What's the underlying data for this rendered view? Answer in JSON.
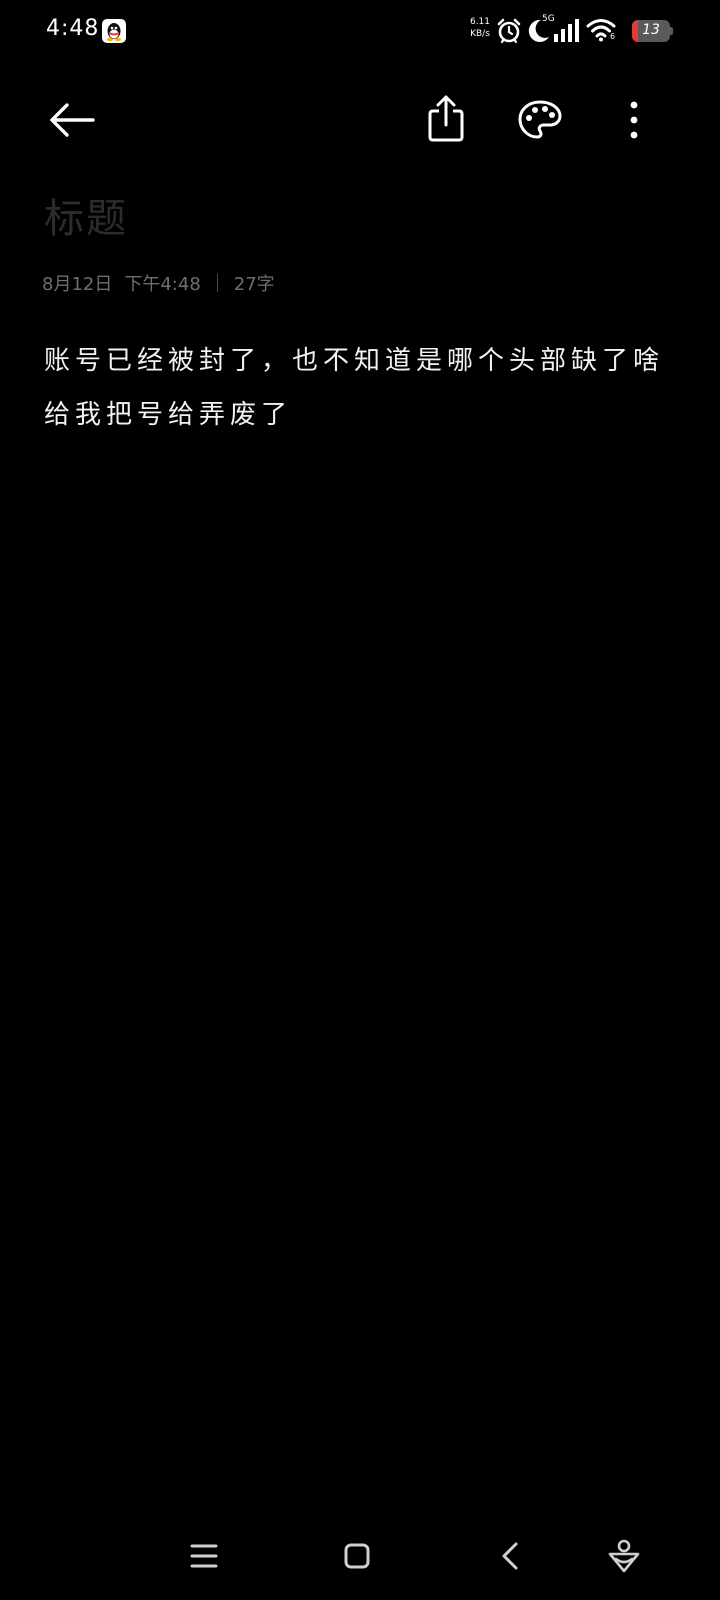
{
  "status_bar": {
    "time": "4:48",
    "net_speed_value": "6.11",
    "net_speed_unit": "KB/s",
    "network_type": "5G",
    "wifi_level": "6",
    "battery": "13",
    "icons": [
      "qq-icon",
      "alarm-icon",
      "do-not-disturb-moon-icon",
      "signal-icon",
      "wifi-icon",
      "battery-icon"
    ]
  },
  "toolbar": {
    "icons": [
      "back-arrow-icon",
      "share-icon",
      "palette-icon",
      "more-vertical-icon"
    ]
  },
  "note": {
    "title_placeholder": "标题",
    "date": "8月12日",
    "time": "下午4:48",
    "char_count": "27字",
    "body": "账号已经被封了，也不知道是哪个头部缺了啥给我把号给弄废了"
  },
  "nav_bar": {
    "icons": [
      "menu-icon",
      "home-icon",
      "back-icon",
      "assistant-icon"
    ]
  },
  "colors": {
    "background": "#000000",
    "text": "#f2f2f2",
    "meta_text": "#6e6e6e",
    "title_placeholder": "#2c2c2c",
    "battery_low": "#e53935"
  }
}
